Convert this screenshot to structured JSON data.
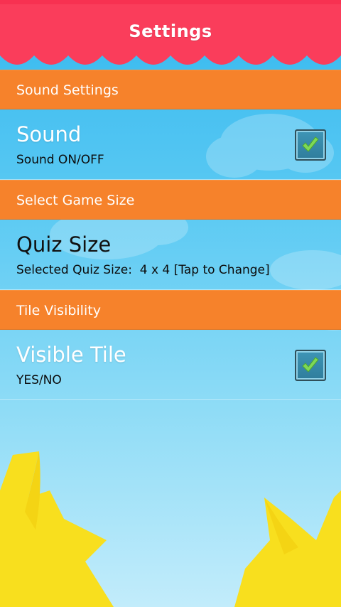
{
  "header": {
    "title": "Settings"
  },
  "sections": [
    {
      "header": "Sound Settings",
      "pref": {
        "title": "Sound",
        "summary": "Sound ON/OFF",
        "checked": true
      }
    },
    {
      "header": "Select Game Size",
      "pref": {
        "title": "Quiz Size",
        "summary": "Selected Quiz Size:  4 x 4 [Tap to Change]"
      }
    },
    {
      "header": "Tile Visibility",
      "pref": {
        "title": "Visible Tile",
        "summary": "YES/NO",
        "checked": true
      }
    }
  ],
  "colors": {
    "awning": "#fa3d5b",
    "section_header": "#f6822b",
    "background": "#35b8ef",
    "check": "#7ed957"
  }
}
